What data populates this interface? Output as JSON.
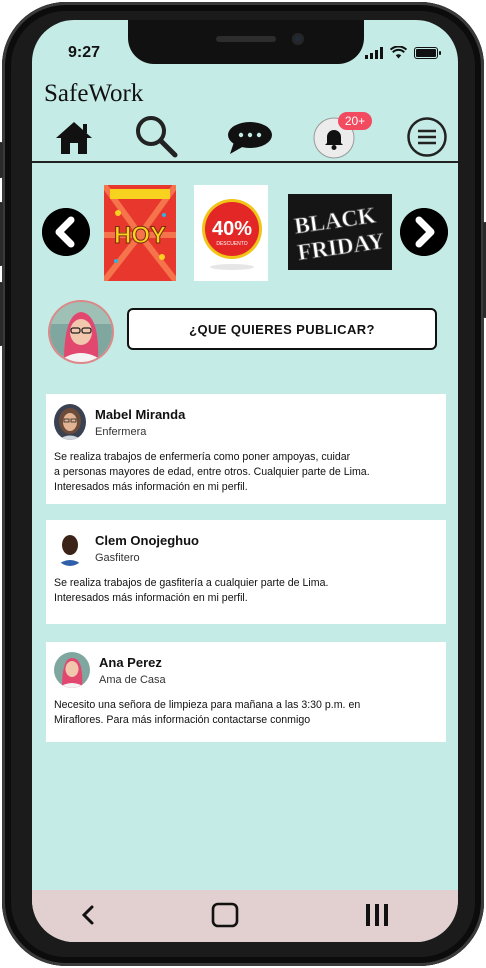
{
  "status": {
    "time": "9:27"
  },
  "app": {
    "brand": "SafeWork"
  },
  "nav": {
    "items": [
      "home-icon",
      "search-icon",
      "chat-icon",
      "notifications-icon",
      "menu-icon"
    ],
    "notification_badge": "20+"
  },
  "carousel": {
    "promos": [
      {
        "icon": "promo-hoy",
        "text": "HOY"
      },
      {
        "icon": "promo-40",
        "text": "40%",
        "subtext": "DESCUENTO"
      },
      {
        "icon": "promo-black-friday",
        "line1": "BLACK",
        "line2": "FRIDAY"
      }
    ]
  },
  "composer": {
    "button_label": "¿QUE QUIERES PUBLICAR?"
  },
  "posts": [
    {
      "name": "Mabel Miranda",
      "role": "Enfermera",
      "body_lines": [
        "Se realiza trabajos de enfermería como poner ampoyas, cuidar",
        "a personas mayores de edad, entre otros. Cualquier parte de Lima.",
        "Interesados más información en mi perfil."
      ]
    },
    {
      "name": "Clem Onojeghuo",
      "role": "Gasfitero",
      "body_lines": [
        "Se realiza trabajos de gasfitería a cualquier parte de Lima.",
        "Interesados más información en mi perfil."
      ]
    },
    {
      "name": "Ana Perez",
      "role": "Ama de Casa",
      "body_lines": [
        "Necesito una señora de limpieza para mañana a las 3:30 p.m. en",
        "Miraflores. Para más información contactarse conmigo"
      ]
    }
  ],
  "colors": {
    "background": "#c4ebe6",
    "badge": "#f24a5f",
    "bottom_bar": "#e2cfcf"
  }
}
